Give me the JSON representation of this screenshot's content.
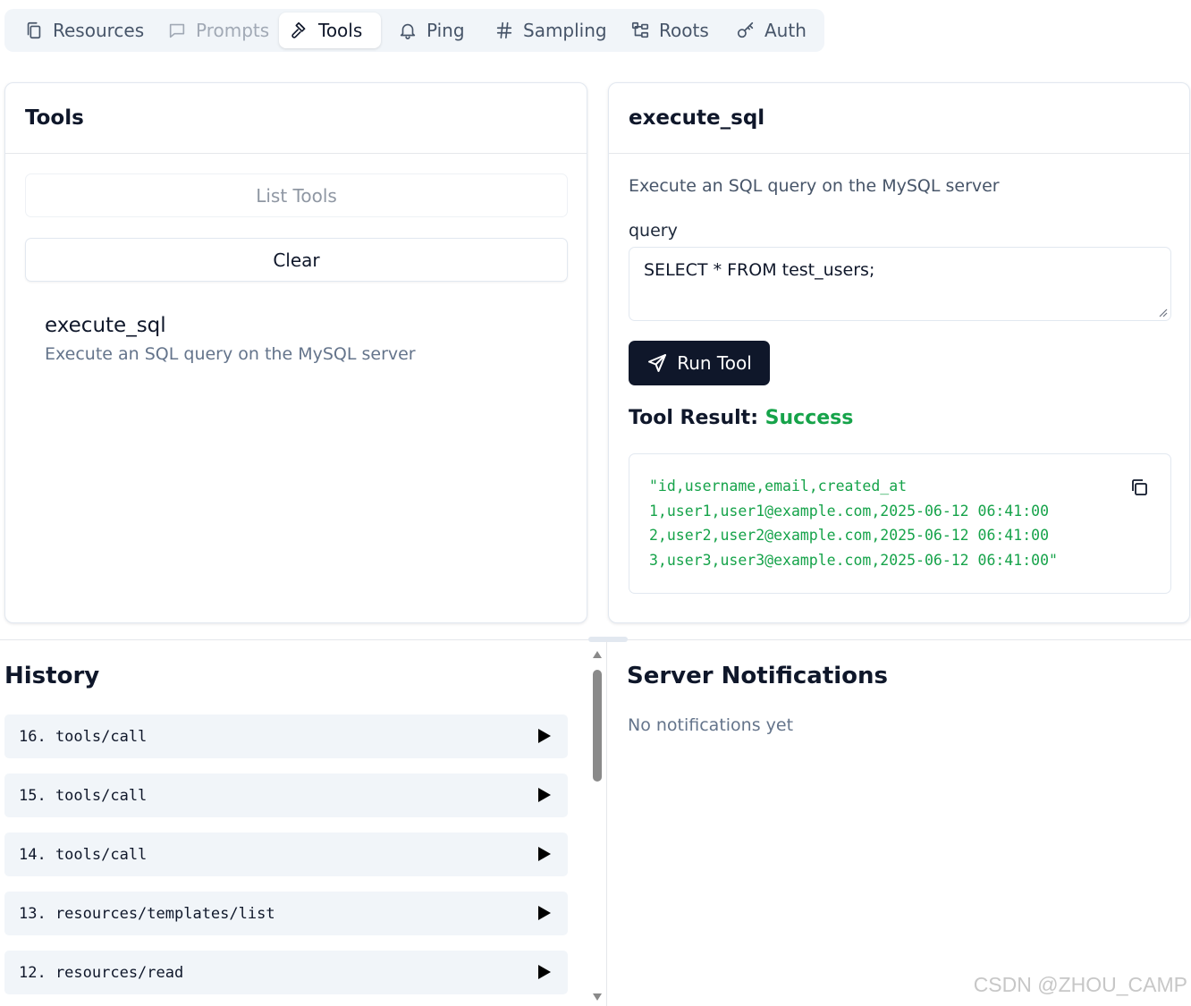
{
  "tabs": [
    {
      "label": "Resources",
      "icon": "files-icon",
      "state": "normal"
    },
    {
      "label": "Prompts",
      "icon": "message-square-icon",
      "state": "disabled"
    },
    {
      "label": "Tools",
      "icon": "hammer-icon",
      "state": "active"
    },
    {
      "label": "Ping",
      "icon": "bell-icon",
      "state": "normal"
    },
    {
      "label": "Sampling",
      "icon": "hash-icon",
      "state": "normal"
    },
    {
      "label": "Roots",
      "icon": "folder-tree-icon",
      "state": "normal"
    },
    {
      "label": "Auth",
      "icon": "key-icon",
      "state": "normal"
    }
  ],
  "tools_panel": {
    "title": "Tools",
    "list_button": "List Tools",
    "clear_button": "Clear",
    "items": [
      {
        "name": "execute_sql",
        "description": "Execute an SQL query on the MySQL server"
      }
    ]
  },
  "detail_panel": {
    "title": "execute_sql",
    "description": "Execute an SQL query on the MySQL server",
    "param_label": "query",
    "param_value": "SELECT * FROM test_users;",
    "run_button": "Run Tool",
    "result_label": "Tool Result:",
    "result_status": "Success",
    "result_text": "\"id,username,email,created_at\n1,user1,user1@example.com,2025-06-12 06:41:00\n2,user2,user2@example.com,2025-06-12 06:41:00\n3,user3,user3@example.com,2025-06-12 06:41:00\""
  },
  "history": {
    "title": "History",
    "items": [
      {
        "label": "16. tools/call"
      },
      {
        "label": "15. tools/call"
      },
      {
        "label": "14. tools/call"
      },
      {
        "label": "13. resources/templates/list"
      },
      {
        "label": "12. resources/read"
      }
    ]
  },
  "notifications": {
    "title": "Server Notifications",
    "empty_text": "No notifications yet"
  },
  "watermark": "CSDN @ZHOU_CAMP",
  "colors": {
    "accent_dark": "#0f172a",
    "success": "#16a34a",
    "muted_bg": "#f1f5f9"
  }
}
